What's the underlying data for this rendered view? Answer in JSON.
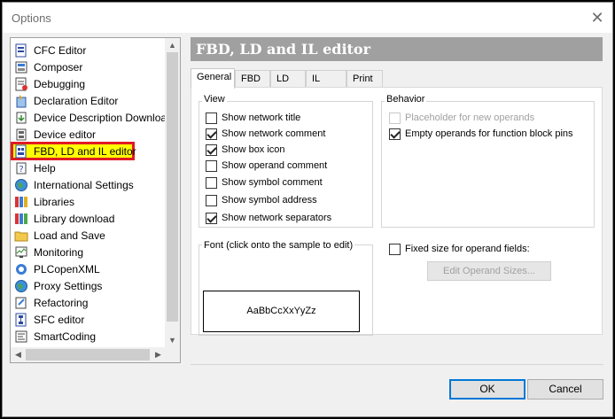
{
  "window": {
    "title": "Options"
  },
  "tree": {
    "items": [
      {
        "label": "CFC Editor",
        "icon": "cfc-editor-icon",
        "selected": false
      },
      {
        "label": "Composer",
        "icon": "composer-icon",
        "selected": false
      },
      {
        "label": "Debugging",
        "icon": "debugging-icon",
        "selected": false
      },
      {
        "label": "Declaration Editor",
        "icon": "declaration-editor-icon",
        "selected": false
      },
      {
        "label": "Device Description Download",
        "icon": "device-description-download-icon",
        "selected": false
      },
      {
        "label": "Device editor",
        "icon": "device-editor-icon",
        "selected": false
      },
      {
        "label": "FBD, LD and IL editor",
        "icon": "fbd-ld-il-editor-icon",
        "selected": true
      },
      {
        "label": "Help",
        "icon": "help-icon",
        "selected": false
      },
      {
        "label": "International Settings",
        "icon": "globe-icon",
        "selected": false
      },
      {
        "label": "Libraries",
        "icon": "libraries-icon",
        "selected": false
      },
      {
        "label": "Library download",
        "icon": "library-download-icon",
        "selected": false
      },
      {
        "label": "Load and Save",
        "icon": "folder-icon",
        "selected": false
      },
      {
        "label": "Monitoring",
        "icon": "monitoring-icon",
        "selected": false
      },
      {
        "label": "PLCopenXML",
        "icon": "plcopenxml-icon",
        "selected": false
      },
      {
        "label": "Proxy Settings",
        "icon": "proxy-settings-icon",
        "selected": false
      },
      {
        "label": "Refactoring",
        "icon": "refactoring-icon",
        "selected": false
      },
      {
        "label": "SFC editor",
        "icon": "sfc-editor-icon",
        "selected": false
      },
      {
        "label": "SmartCoding",
        "icon": "smartcoding-icon",
        "selected": false
      }
    ]
  },
  "panel": {
    "header": "FBD, LD and IL editor",
    "tabs": [
      "General",
      "FBD",
      "LD",
      "IL",
      "Print"
    ],
    "active_tab": "General",
    "view": {
      "label": "View",
      "options": [
        {
          "label": "Show network title",
          "checked": false
        },
        {
          "label": "Show network comment",
          "checked": true
        },
        {
          "label": "Show box icon",
          "checked": true
        },
        {
          "label": "Show operand comment",
          "checked": false
        },
        {
          "label": "Show symbol comment",
          "checked": false
        },
        {
          "label": "Show symbol address",
          "checked": false
        },
        {
          "label": "Show network separators",
          "checked": true
        }
      ]
    },
    "behavior": {
      "label": "Behavior",
      "options": [
        {
          "label": "Placeholder for new operands",
          "checked": false,
          "disabled": true
        },
        {
          "label": "Empty operands for function block pins",
          "checked": true,
          "disabled": false
        }
      ]
    },
    "font": {
      "label": "Font (click onto the sample to edit)",
      "sample": "AaBbCcXxYyZz"
    },
    "fixed_size": {
      "label": "Fixed size for operand fields:",
      "checked": false
    },
    "edit_operand_sizes_label": "Edit Operand Sizes..."
  },
  "buttons": {
    "ok": "OK",
    "cancel": "Cancel"
  },
  "colors": {
    "selection_highlight": "#ffff00",
    "selection_border": "#e01b24",
    "header_bg": "#a0a0a0",
    "default_button_border": "#0078d7"
  }
}
